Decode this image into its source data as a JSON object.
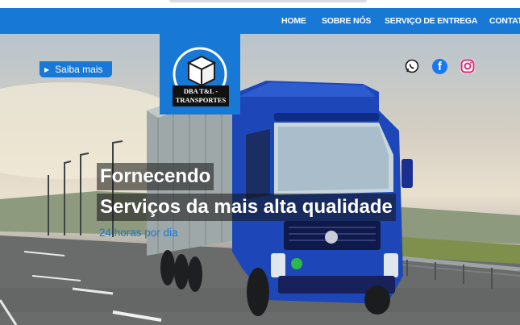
{
  "nav": {
    "items": [
      "HOME",
      "SOBRE NÓS",
      "SERVIÇO DE ENTREGA",
      "CONTATO"
    ]
  },
  "hero": {
    "button_label": "Saiba mais",
    "line1": "Fornecendo",
    "line2": "Serviços da mais alta qualidade",
    "line3": "24 horas por dia"
  },
  "logo": {
    "text_line1": "DBA T&L -",
    "text_line2": "TRANSPORTES"
  },
  "social": {
    "icons": [
      "whatsapp-icon",
      "facebook-icon",
      "instagram-icon"
    ]
  },
  "colors": {
    "primary": "#1878d6",
    "whatsapp": "#25d366",
    "facebook": "#1877f2",
    "instagram": "#d62976"
  }
}
